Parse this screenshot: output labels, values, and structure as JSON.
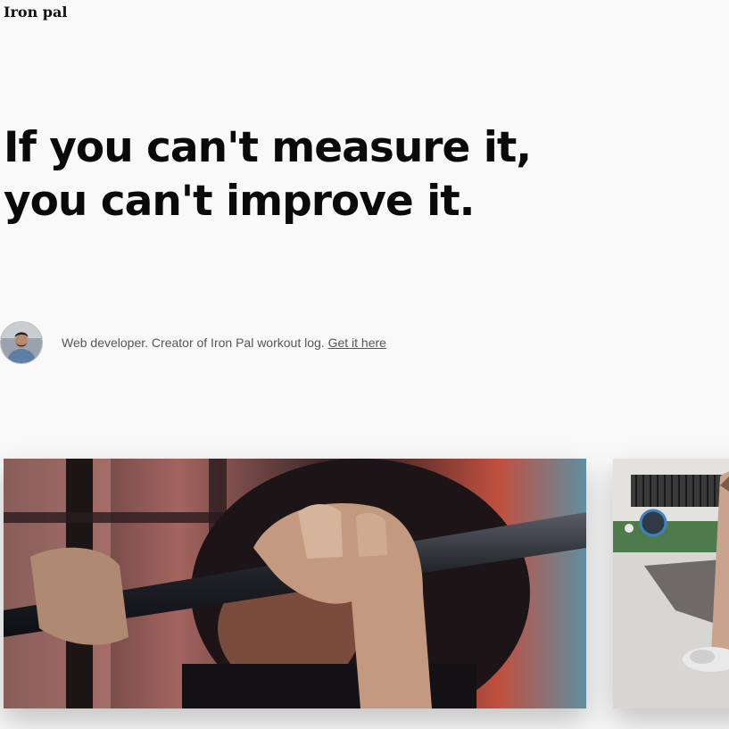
{
  "site": {
    "title": "Iron pal"
  },
  "hero": {
    "headline": "If you can't measure it, you can't improve it."
  },
  "author": {
    "bio_text": "Web developer. Creator of Iron Pal workout log. ",
    "link_label": "Get it here"
  },
  "posts": [
    {
      "image": "barbell-grip-photo"
    },
    {
      "image": "gym-floor-photo"
    }
  ]
}
